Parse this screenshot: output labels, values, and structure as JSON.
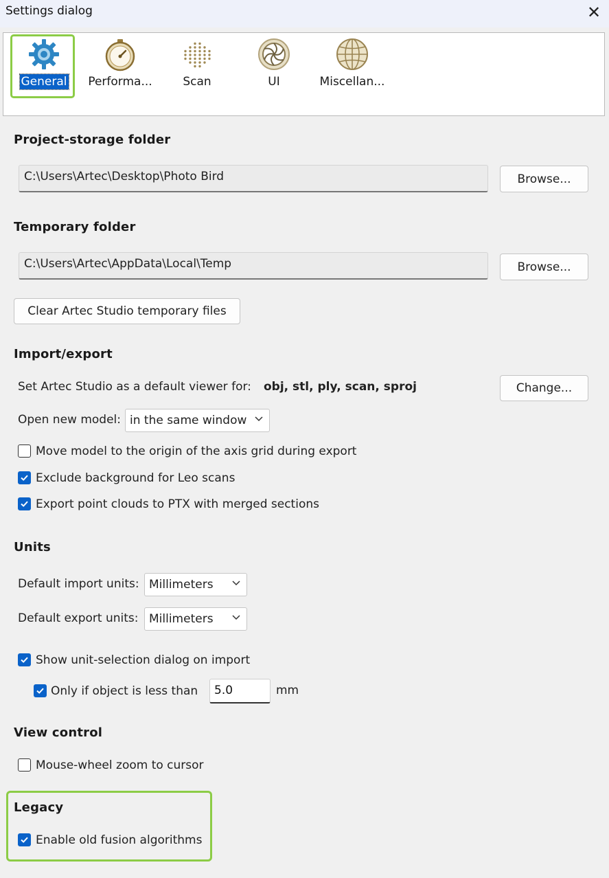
{
  "window": {
    "title": "Settings dialog",
    "close_glyph": "✕"
  },
  "tabs": [
    {
      "label": "General",
      "icon": "gear-icon",
      "active": true
    },
    {
      "label": "Performa...",
      "icon": "stopwatch-icon",
      "active": false
    },
    {
      "label": "Scan",
      "icon": "dot-grid-icon",
      "active": false
    },
    {
      "label": "UI",
      "icon": "aperture-icon",
      "active": false
    },
    {
      "label": "Miscellan...",
      "icon": "globe-icon",
      "active": false
    }
  ],
  "project_storage": {
    "heading": "Project-storage folder",
    "path": "C:\\Users\\Artec\\Desktop\\Photo Bird",
    "browse_label": "Browse..."
  },
  "temporary": {
    "heading": "Temporary folder",
    "path": "C:\\Users\\Artec\\AppData\\Local\\Temp",
    "browse_label": "Browse...",
    "clear_label": "Clear Artec Studio temporary files"
  },
  "import_export": {
    "heading": "Import/export",
    "default_viewer_label": "Set Artec Studio as a default viewer for:",
    "default_viewer_formats": "obj, stl, ply, scan, sproj",
    "change_label": "Change...",
    "open_new_model_label": "Open new model:",
    "open_new_model_value": "in the same window",
    "checkboxes": [
      {
        "label": "Move model to the origin of the axis grid during export",
        "checked": false
      },
      {
        "label": "Exclude background for Leo scans",
        "checked": true
      },
      {
        "label": "Export point clouds to PTX with merged sections",
        "checked": true
      }
    ]
  },
  "units": {
    "heading": "Units",
    "import_label": "Default import units:",
    "import_value": "Millimeters",
    "export_label": "Default export units:",
    "export_value": "Millimeters",
    "show_dialog_label": "Show unit-selection dialog on import",
    "show_dialog_checked": true,
    "only_if_label": "Only if object is less than",
    "only_if_checked": true,
    "threshold_value": "5.0",
    "threshold_unit": "mm"
  },
  "view_control": {
    "heading": "View control",
    "mouse_wheel_label": "Mouse-wheel zoom to cursor",
    "mouse_wheel_checked": false
  },
  "legacy": {
    "heading": "Legacy",
    "old_fusion_label": "Enable old fusion algorithms",
    "old_fusion_checked": true
  },
  "colors": {
    "accent": "#0a62c9",
    "highlight": "#8ccc46",
    "background": "#f0f0f0"
  }
}
